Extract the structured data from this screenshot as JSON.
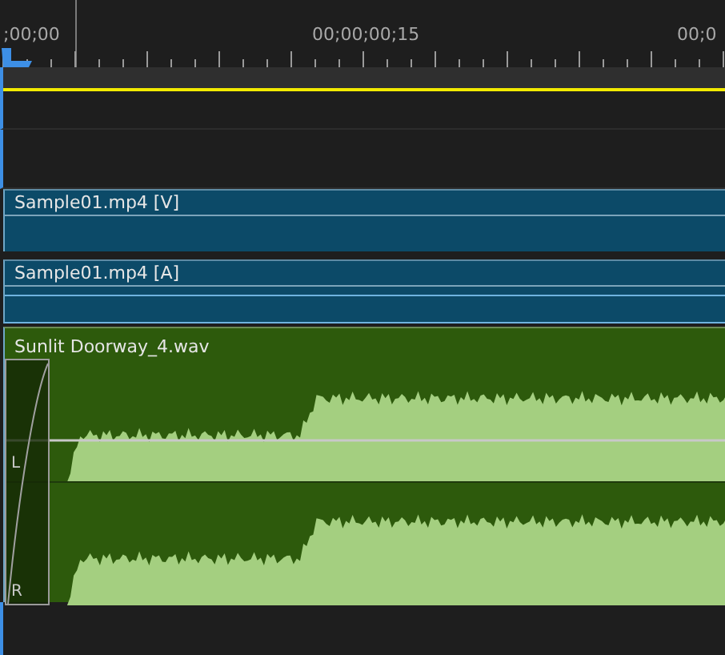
{
  "ruler": {
    "timecodes": [
      {
        "label": ";00;00"
      },
      {
        "label": "00;00;00;15"
      },
      {
        "label": "00;0"
      }
    ]
  },
  "clips": [
    {
      "kind": "video",
      "name": "Sample01.mp4 [V]"
    },
    {
      "kind": "audio",
      "name": "Sample01.mp4 [A]"
    },
    {
      "kind": "wav",
      "name": "Sunlit Doorway_4.wav",
      "channels": [
        "L",
        "R"
      ]
    }
  ]
}
